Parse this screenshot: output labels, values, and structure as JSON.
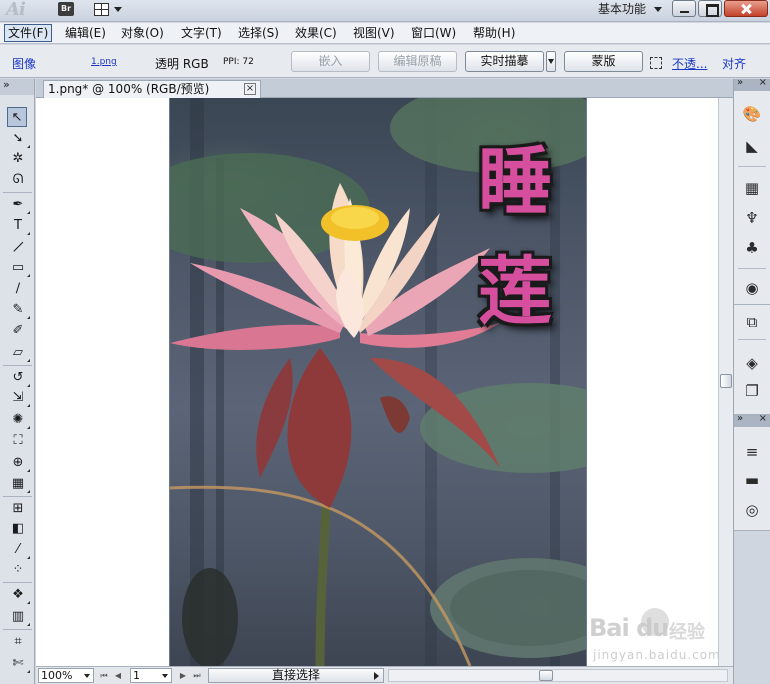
{
  "titlebar": {
    "app_logo": "Ai",
    "bridge_label": "Br",
    "workspace": "基本功能"
  },
  "menu": {
    "items": [
      "文件(F)",
      "编辑(E)",
      "对象(O)",
      "文字(T)",
      "选择(S)",
      "效果(C)",
      "视图(V)",
      "窗口(W)",
      "帮助(H)"
    ]
  },
  "control": {
    "object_type": "图像",
    "filename": "1.png",
    "color_mode": "透明 RGB",
    "ppi": "PPI: 72",
    "embed_label": "嵌入",
    "edit_original_label": "编辑原稿",
    "live_trace_label": "实时描摹",
    "mask_label": "蒙版",
    "opacity_link": "不透...",
    "align_link": "对齐"
  },
  "document": {
    "tab_title": "1.png* @ 100% (RGB/预览)",
    "tab_close": "×",
    "title_chars": [
      "睡",
      "莲"
    ]
  },
  "status": {
    "zoom": "100%",
    "page": "1",
    "tool_name": "直接选择"
  },
  "watermark": {
    "logo": "Bai  du",
    "site_name": "经验",
    "url": "jingyan.baidu.com"
  },
  "colors": {
    "title_text": "#d64f9e",
    "link": "#1a37c8"
  }
}
